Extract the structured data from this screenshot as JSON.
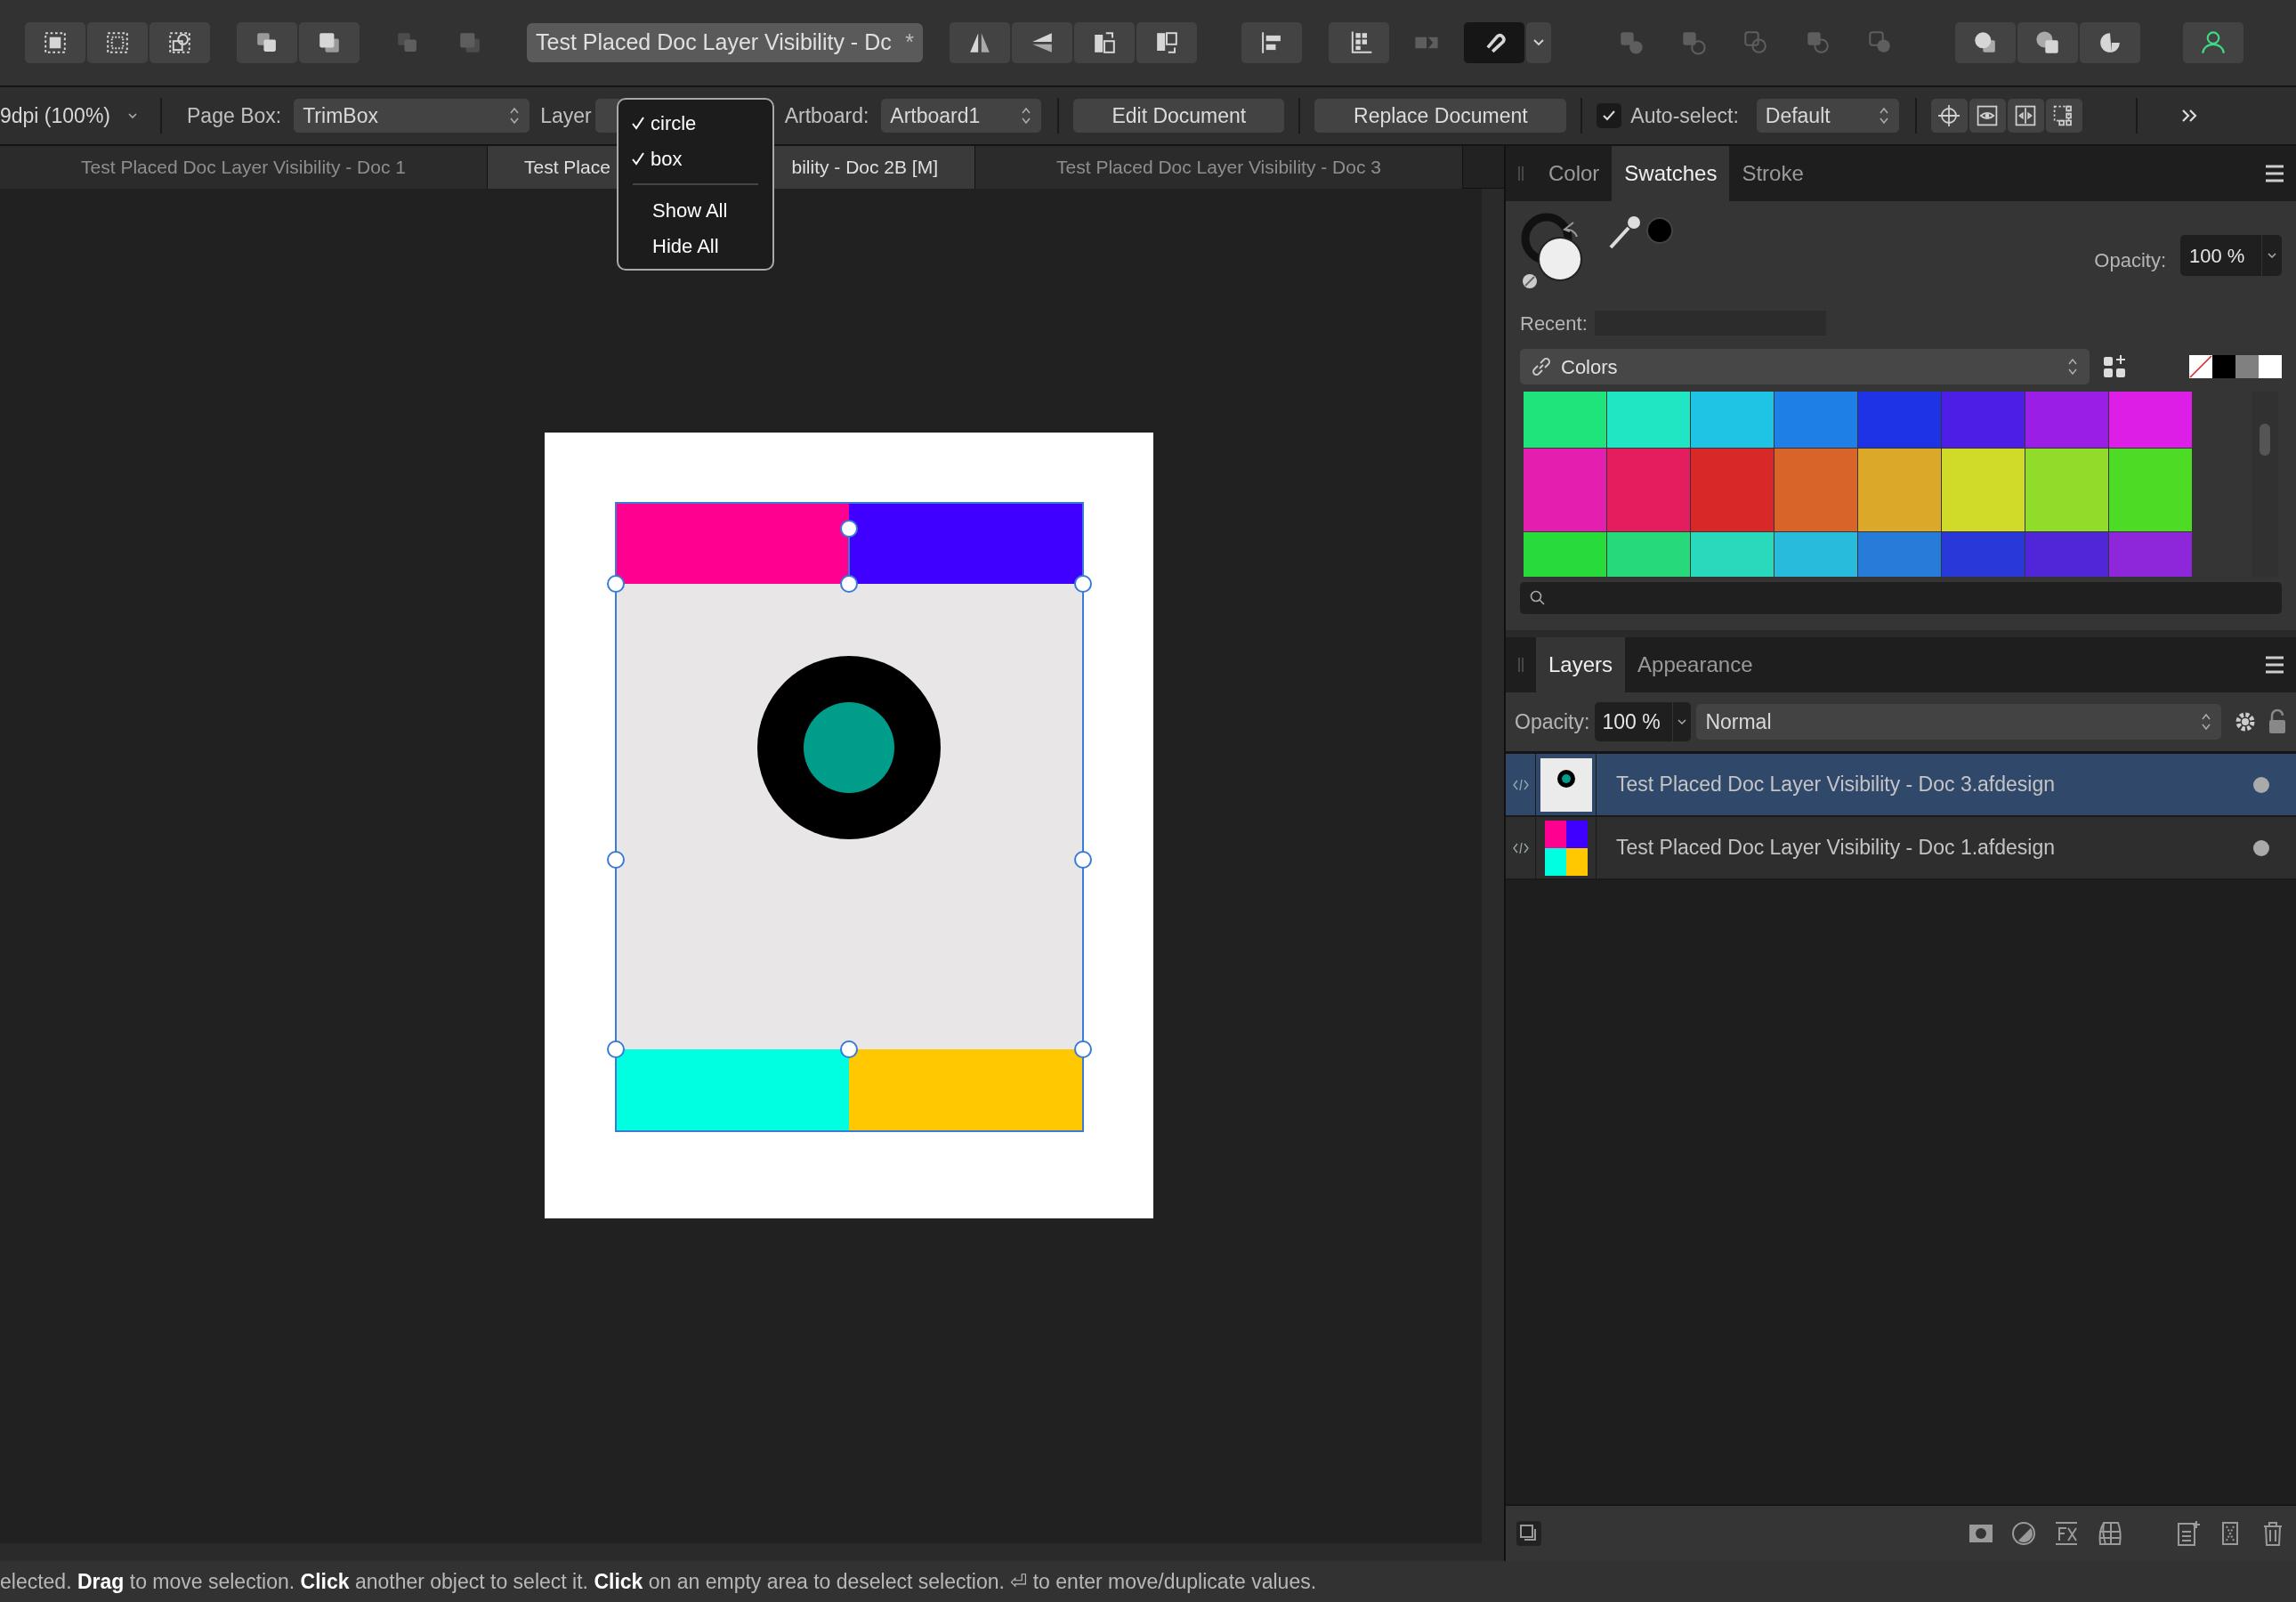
{
  "toolbar": [
    {
      "kind": "group",
      "buttons": [
        {
          "kind": "select-all",
          "disabled": false,
          "on": false
        },
        {
          "kind": "select-none",
          "disabled": false,
          "on": false
        },
        {
          "kind": "select-similar",
          "disabled": false,
          "on": false
        }
      ]
    },
    {
      "kind": "group",
      "buttons": [
        {
          "kind": "forward",
          "disabled": false,
          "on": false
        },
        {
          "kind": "back",
          "disabled": false,
          "on": false
        }
      ]
    },
    {
      "kind": "loose",
      "buttons": [
        {
          "kind": "forward",
          "disabled": true,
          "on": false
        },
        {
          "kind": "back",
          "disabled": true,
          "on": false
        }
      ]
    },
    {
      "kind": "title",
      "text": "Test Placed Doc Layer Visibility - Dc",
      "mark": "*"
    },
    {
      "kind": "group",
      "buttons": [
        {
          "kind": "flip-h",
          "disabled": false,
          "on": false
        },
        {
          "kind": "flip-v",
          "disabled": false,
          "on": false
        },
        {
          "kind": "rotate-left",
          "disabled": false,
          "on": false
        },
        {
          "kind": "rotate-right",
          "disabled": false,
          "on": false
        }
      ]
    },
    {
      "kind": "group",
      "buttons": [
        {
          "kind": "align",
          "disabled": false,
          "on": false
        }
      ]
    },
    {
      "kind": "group",
      "buttons": [
        {
          "kind": "snap-grid",
          "disabled": false,
          "on": false
        }
      ]
    },
    {
      "kind": "loose",
      "buttons": [
        {
          "kind": "snap-toggle",
          "disabled": true,
          "on": false
        }
      ]
    },
    {
      "kind": "group",
      "buttons": [
        {
          "kind": "magnet",
          "disabled": false,
          "on": true
        },
        {
          "kind": "caret",
          "disabled": false,
          "on": false
        }
      ]
    },
    {
      "kind": "loose",
      "buttons": [
        {
          "kind": "bool-add",
          "disabled": true,
          "on": false
        },
        {
          "kind": "bool-subtract",
          "disabled": true,
          "on": false
        },
        {
          "kind": "bool-intersect",
          "disabled": true,
          "on": false
        },
        {
          "kind": "bool-xor",
          "disabled": true,
          "on": false
        },
        {
          "kind": "bool-divide",
          "disabled": true,
          "on": false
        }
      ]
    },
    {
      "kind": "group",
      "buttons": [
        {
          "kind": "geo-1",
          "disabled": false,
          "on": false
        },
        {
          "kind": "geo-2",
          "disabled": false,
          "on": false
        },
        {
          "kind": "geo-3",
          "disabled": false,
          "on": false
        }
      ]
    },
    {
      "kind": "group",
      "buttons": [
        {
          "kind": "person",
          "disabled": false,
          "on": false
        }
      ]
    }
  ],
  "context_bar": {
    "dpi": "9dpi (100%)",
    "page_box_label": "Page Box:",
    "page_box": "TrimBox",
    "layers_label": "Layer",
    "artboard_label": "Artboard:",
    "artboard": "Artboard1",
    "buttons": [
      "Edit Document",
      "Replace Document"
    ],
    "auto_select": {
      "checked": true,
      "label": "Auto-select:",
      "value": "Default"
    }
  },
  "layers_menu": {
    "items": [
      {
        "label": "circle",
        "checked": true
      },
      {
        "label": "box",
        "checked": true
      }
    ],
    "actions": [
      "Show All",
      "Hide All"
    ]
  },
  "document_tabs": [
    {
      "parts": [
        "Test Placed Doc Layer Visibility - Doc 1"
      ],
      "selected": false
    },
    {
      "parts": [
        "Test Place",
        "bility - Doc 2B [M]"
      ],
      "selected": true
    },
    {
      "parts": [
        "Test Placed Doc Layer Visibility - Doc 3"
      ],
      "selected": false
    }
  ],
  "swatches_panel": {
    "tabs": [
      {
        "label": "Color",
        "selected": false
      },
      {
        "label": "Swatches",
        "selected": true
      },
      {
        "label": "Stroke",
        "selected": false
      }
    ],
    "opacity_label": "Opacity:",
    "opacity": "100 %",
    "recent_label": "Recent:",
    "palette": "Colors",
    "quick_colors": [
      {
        "kind": "none"
      },
      {
        "kind": "color",
        "color": "#000000"
      },
      {
        "kind": "color",
        "color": "#808080"
      },
      {
        "kind": "color",
        "color": "#ffffff"
      }
    ],
    "rows": [
      [
        {
          "color": "#1fe47c"
        },
        {
          "color": "#20e6c4"
        },
        {
          "color": "#1fc3e4"
        },
        {
          "color": "#1e7fe6"
        },
        {
          "color": "#1e33e6"
        },
        {
          "color": "#4c1ee6"
        },
        {
          "color": "#9a1ee6"
        },
        {
          "color": "#dc1ee6"
        }
      ],
      [
        {
          "color": "#e41fb0"
        },
        {
          "color": "#e41e5e"
        },
        {
          "color": "#d92828"
        },
        {
          "color": "#d9642a"
        },
        {
          "color": "#dba82a"
        },
        {
          "color": "#cfdb28"
        },
        {
          "color": "#91db2a"
        },
        {
          "color": "#4ddb26"
        }
      ],
      [
        {
          "color": "#27db3b"
        },
        {
          "color": "#26d97b"
        },
        {
          "color": "#28d9bc"
        },
        {
          "color": "#28bbdb"
        },
        {
          "color": "#287cd9"
        },
        {
          "color": "#2838d9"
        },
        {
          "color": "#5126d9"
        },
        {
          "color": "#8e26d9"
        }
      ]
    ]
  },
  "layers_panel": {
    "tabs": [
      {
        "label": "Layers",
        "selected": true
      },
      {
        "label": "Appearance",
        "selected": false
      }
    ],
    "opacity_label": "Opacity:",
    "opacity": "100 %",
    "blend_mode": "Normal",
    "layers": [
      {
        "name": "Test Placed Doc Layer Visibility - Doc 3.afdesign",
        "kind": "circle",
        "selected": true,
        "visible": true
      },
      {
        "name": "Test Placed Doc Layer Visibility - Doc 1.afdesign",
        "kind": "quad",
        "selected": false,
        "visible": true
      }
    ]
  },
  "status_bar": "elected. **Drag** to move selection. **Click** another object to select it. **Click** on an empty area to deselect selection. ⏎ to enter move/duplicate values."
}
